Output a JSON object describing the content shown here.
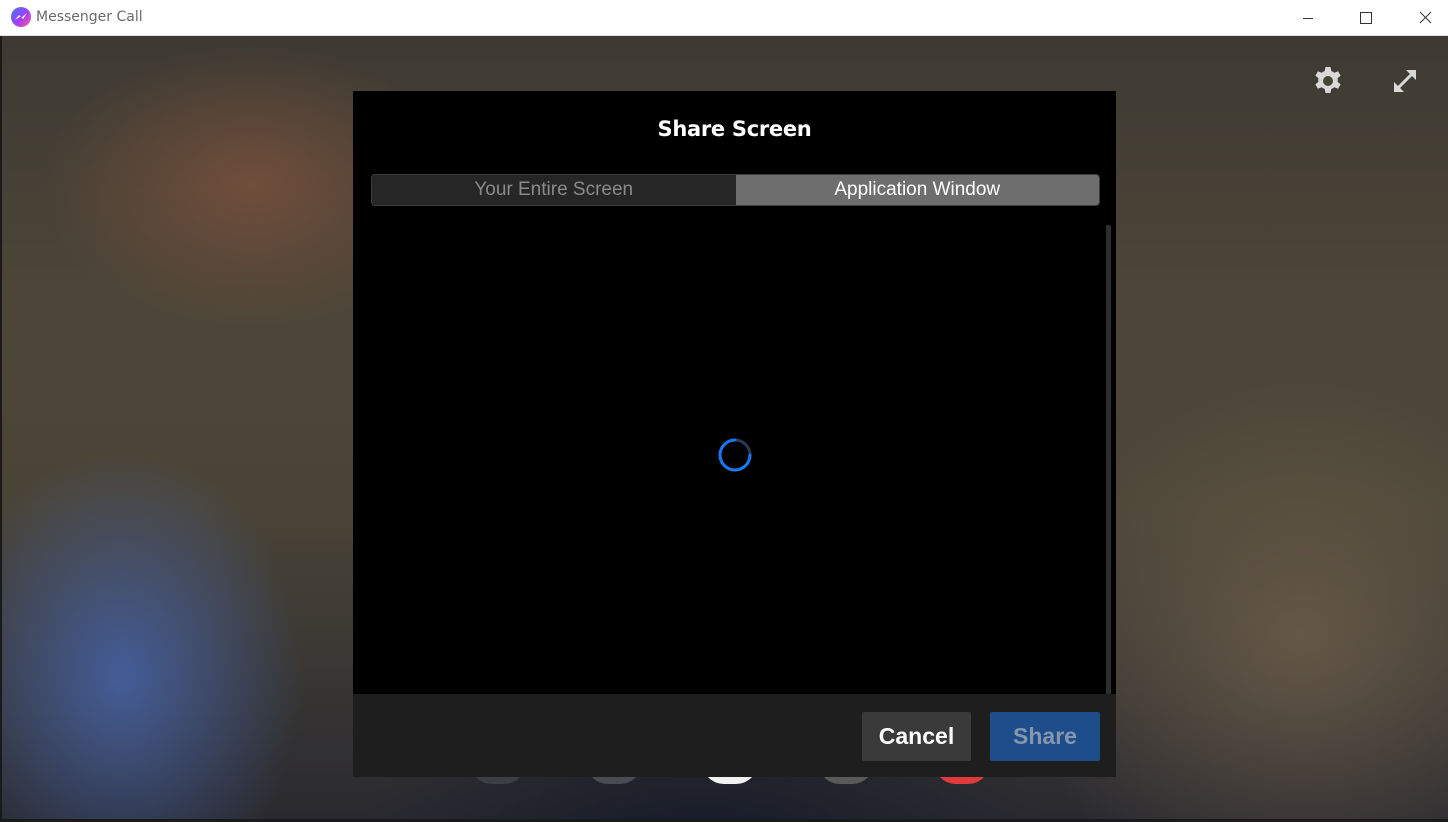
{
  "window": {
    "title": "Messenger Call"
  },
  "dialog": {
    "title": "Share Screen",
    "tabs": [
      {
        "label": "Your Entire Screen",
        "selected": false
      },
      {
        "label": "Application Window",
        "selected": true
      }
    ],
    "content_state": "loading",
    "buttons": {
      "cancel_label": "Cancel",
      "share_label": "Share"
    }
  },
  "icons": {
    "app": "messenger-icon",
    "settings": "gear-icon",
    "expand": "expand-icon",
    "minimize": "minimize-icon",
    "maximize": "maximize-icon",
    "close": "close-icon",
    "spinner": "loading-spinner-icon"
  },
  "colors": {
    "dialog_background": "#000000",
    "active_tab": "#6e6e6e",
    "inactive_tab": "#262626",
    "share_button": "#1e4d8c",
    "cancel_button": "#3a3a3a",
    "spinner": "#1877f2"
  }
}
